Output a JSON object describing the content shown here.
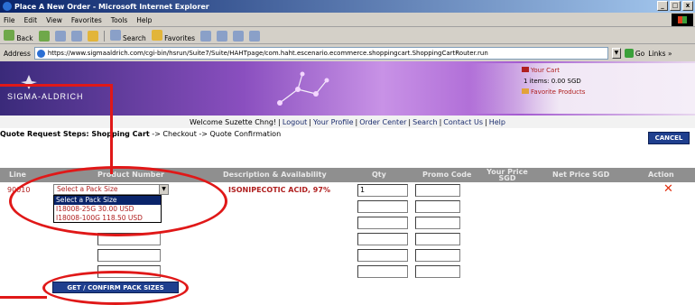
{
  "browser": {
    "title": "Place A New Order - Microsoft Internet Explorer",
    "menu": [
      "File",
      "Edit",
      "View",
      "Favorites",
      "Tools",
      "Help"
    ],
    "toolbar": {
      "back": "Back",
      "search": "Search",
      "favorites": "Favorites"
    },
    "address_label": "Address",
    "address_value": "https://www.sigmaaldrich.com/cgi-bin/hsrun/Suite7/Suite/HAHTpage/com.haht.escenario.ecommerce.shoppingcart.ShoppingCartRouter.run",
    "go_label": "Go",
    "links_label": "Links",
    "links_more": "»"
  },
  "site": {
    "logo": "SIGMA-ALDRICH",
    "cart_link": "Your Cart",
    "cart_summary": "1 items: 0.00 SGD",
    "favorites_link": "Favorite Products",
    "welcome": "Welcome Suzette Chng!",
    "nav": [
      "Logout",
      "Your Profile",
      "Order Center",
      "Search",
      "Contact Us",
      "Help"
    ]
  },
  "steps": {
    "prefix": "Quote Request Steps: ",
    "current": "Shopping Cart",
    "rest": " -> Checkout -> Quote Confirmation"
  },
  "cancel_label": "CANCEL",
  "table": {
    "headers": {
      "line": "Line",
      "product_number": "Product Number",
      "description": "Description & Availability",
      "qty": "Qty",
      "promo": "Promo Code",
      "your_price_1": "Your Price",
      "your_price_2": "SGD",
      "net_price": "Net Price SGD",
      "action": "Action"
    },
    "row": {
      "line": "90010",
      "selected": "Select a Pack Size",
      "description": "ISONIPECOTIC ACID, 97%",
      "qty": "1",
      "options": [
        "Select a Pack Size",
        "I18008-25G 30.00 USD",
        "I18008-100G 118.50 USD"
      ],
      "delete_glyph": "✕"
    }
  },
  "confirm_label": "GET / CONFIRM PACK SIZES",
  "colors": {
    "accent_red": "#b02020",
    "button_blue": "#1f3f8e",
    "annotation": "#e01818"
  }
}
